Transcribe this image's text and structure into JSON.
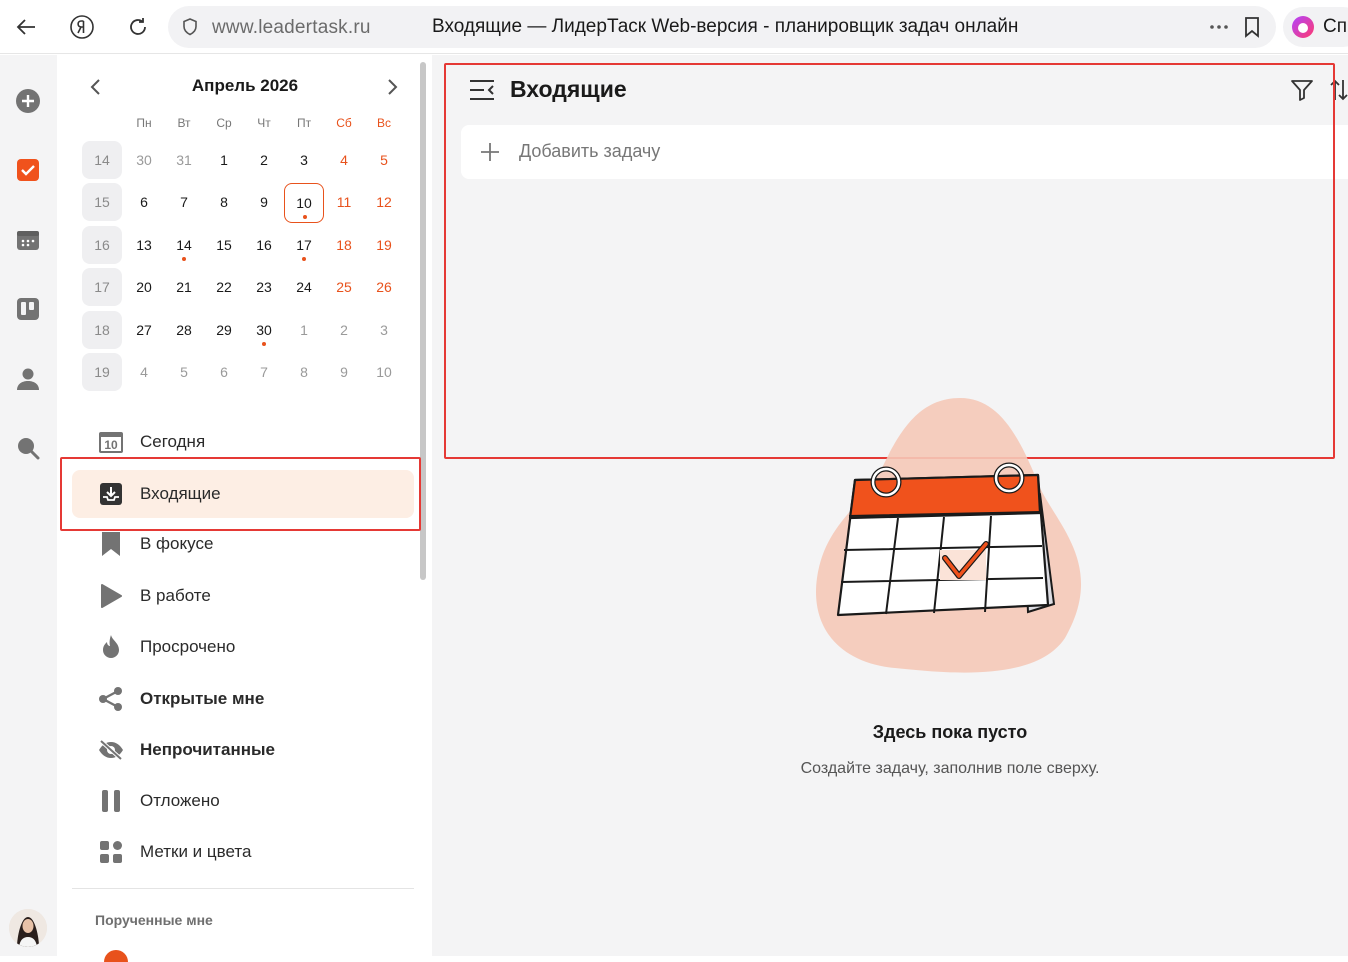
{
  "browser": {
    "url": "www.leadertask.ru",
    "title": "Входящие — ЛидерТаск Web-версия - планировщик задач онлайн",
    "alice_label": "Спр"
  },
  "calendar": {
    "title": "Апрель 2026",
    "weekdays": [
      "Пн",
      "Вт",
      "Ср",
      "Чт",
      "Пт",
      "Сб",
      "Вс"
    ],
    "weeks": [
      {
        "num": "14",
        "days": [
          "30",
          "31",
          "1",
          "2",
          "3",
          "4",
          "5"
        ]
      },
      {
        "num": "15",
        "days": [
          "6",
          "7",
          "8",
          "9",
          "10",
          "11",
          "12"
        ]
      },
      {
        "num": "16",
        "days": [
          "13",
          "14",
          "15",
          "16",
          "17",
          "18",
          "19"
        ]
      },
      {
        "num": "17",
        "days": [
          "20",
          "21",
          "22",
          "23",
          "24",
          "25",
          "26"
        ]
      },
      {
        "num": "18",
        "days": [
          "27",
          "28",
          "29",
          "30",
          "1",
          "2",
          "3"
        ]
      },
      {
        "num": "19",
        "days": [
          "4",
          "5",
          "6",
          "7",
          "8",
          "9",
          "10"
        ]
      }
    ],
    "today": "10"
  },
  "nav": {
    "items": [
      {
        "label": "Сегодня",
        "icon": "today-calendar-icon",
        "icon_text": "10"
      },
      {
        "label": "Входящие",
        "icon": "inbox-icon"
      },
      {
        "label": "В фокусе",
        "icon": "bookmark-icon"
      },
      {
        "label": "В работе",
        "icon": "play-icon"
      },
      {
        "label": "Просрочено",
        "icon": "flame-icon"
      },
      {
        "label": "Открытые мне",
        "icon": "share-icon"
      },
      {
        "label": "Непрочитанные",
        "icon": "eye-off-icon"
      },
      {
        "label": "Отложено",
        "icon": "pause-icon"
      },
      {
        "label": "Метки и цвета",
        "icon": "tags-icon"
      }
    ],
    "section_title": "Порученные мне"
  },
  "main": {
    "title": "Входящие",
    "add_task_placeholder": "Добавить задачу",
    "empty_title": "Здесь пока пусто",
    "empty_subtitle": "Создайте задачу, заполнив поле сверху."
  },
  "colors": {
    "accent": "#e8521c",
    "active_bg": "#fdeee4",
    "highlight_box": "#e53935"
  }
}
